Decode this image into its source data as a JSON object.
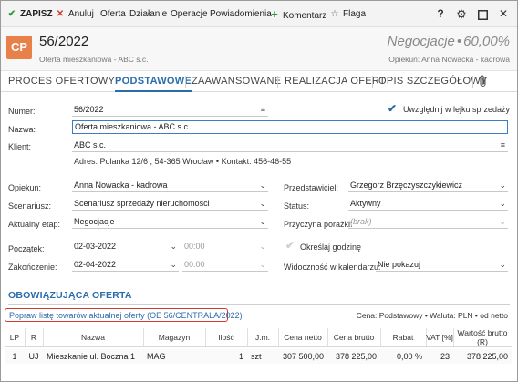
{
  "toolbar": {
    "save": "ZAPISZ",
    "cancel": "Anuluj",
    "offer": "Oferta",
    "action": "Działanie",
    "operations": "Operacje",
    "notifications": "Powiadomienia",
    "comment": "Komentarz",
    "flag": "Flaga",
    "help": "?"
  },
  "header": {
    "avatar": "CP",
    "record_id": "56/2022",
    "subtitle": "Oferta mieszkaniowa - ABC s.c.",
    "stage": "Negocjacje",
    "stage_sep": "•",
    "percent": "60,00%",
    "owner": "Opiekun: Anna Nowacka - kadrowa"
  },
  "tabs": [
    "PROCES OFERTOWY",
    "PODSTAWOWE",
    "ZAAWANSOWANE",
    "REALIZACJA OFERT",
    "OPIS SZCZEGÓŁOWY"
  ],
  "form": {
    "numer_label": "Numer:",
    "numer_value": "56/2022",
    "funnel_label": "Uwzględnij w lejku sprzedaży",
    "nazwa_label": "Nazwa:",
    "nazwa_value": "Oferta mieszkaniowa - ABC s.c.",
    "klient_label": "Klient:",
    "klient_value": "ABC s.c.",
    "adres": "Adres: Polanka  12/6 , 54-365 Wrocław  •  Kontakt:  456-46-55",
    "opiekun_label": "Opiekun:",
    "opiekun_value": "Anna Nowacka - kadrowa",
    "przedstawiciel_label": "Przedstawiciel:",
    "przedstawiciel_value": "Grzegorz Brzęczyszczykiewicz",
    "scenariusz_label": "Scenariusz:",
    "scenariusz_value": "Scenariusz sprzedaży nieruchomości",
    "status_label": "Status:",
    "status_value": "Aktywny",
    "etap_label": "Aktualny etap:",
    "etap_value": "Negocjacje",
    "przyczyna_label": "Przyczyna porażki:",
    "przyczyna_value": "(brak)",
    "poczatek_label": "Początek:",
    "poczatek_date": "02-03-2022",
    "poczatek_time": "00:00",
    "godzina_label": "Określaj godzinę",
    "zakonczenie_label": "Zakończenie:",
    "zakonczenie_date": "02-04-2022",
    "zakonczenie_time": "00:00",
    "widocznosc_label": "Widoczność w kalendarzu:",
    "widocznosc_value": "Nie pokazuj"
  },
  "offer": {
    "title": "OBOWIĄZUJĄCA OFERTA",
    "link": "Popraw listę towarów aktualnej oferty (OE 56/CENTRALA/2022)",
    "pricing": "Cena: Podstawowy • Waluta: PLN • od netto"
  },
  "table": {
    "headers": [
      "LP",
      "R",
      "Nazwa",
      "Magazyn",
      "Ilość",
      "J.m.",
      "Cena netto",
      "Cena brutto",
      "Rabat",
      "VAT [%]",
      "Wartość brutto (R)"
    ],
    "rows": [
      [
        "1",
        "UJ",
        "Mieszkanie ul. Boczna 1",
        "MAG",
        "1",
        "szt",
        "307 500,00",
        "378 225,00",
        "0,00 %",
        "23",
        "378 225,00"
      ]
    ]
  },
  "colors": {
    "accent": "#2b6cab",
    "avatar": "#e8804a",
    "save_check": "#2e9b3a",
    "cancel_x": "#d23a2f",
    "highlight_box": "#d23a2f"
  }
}
